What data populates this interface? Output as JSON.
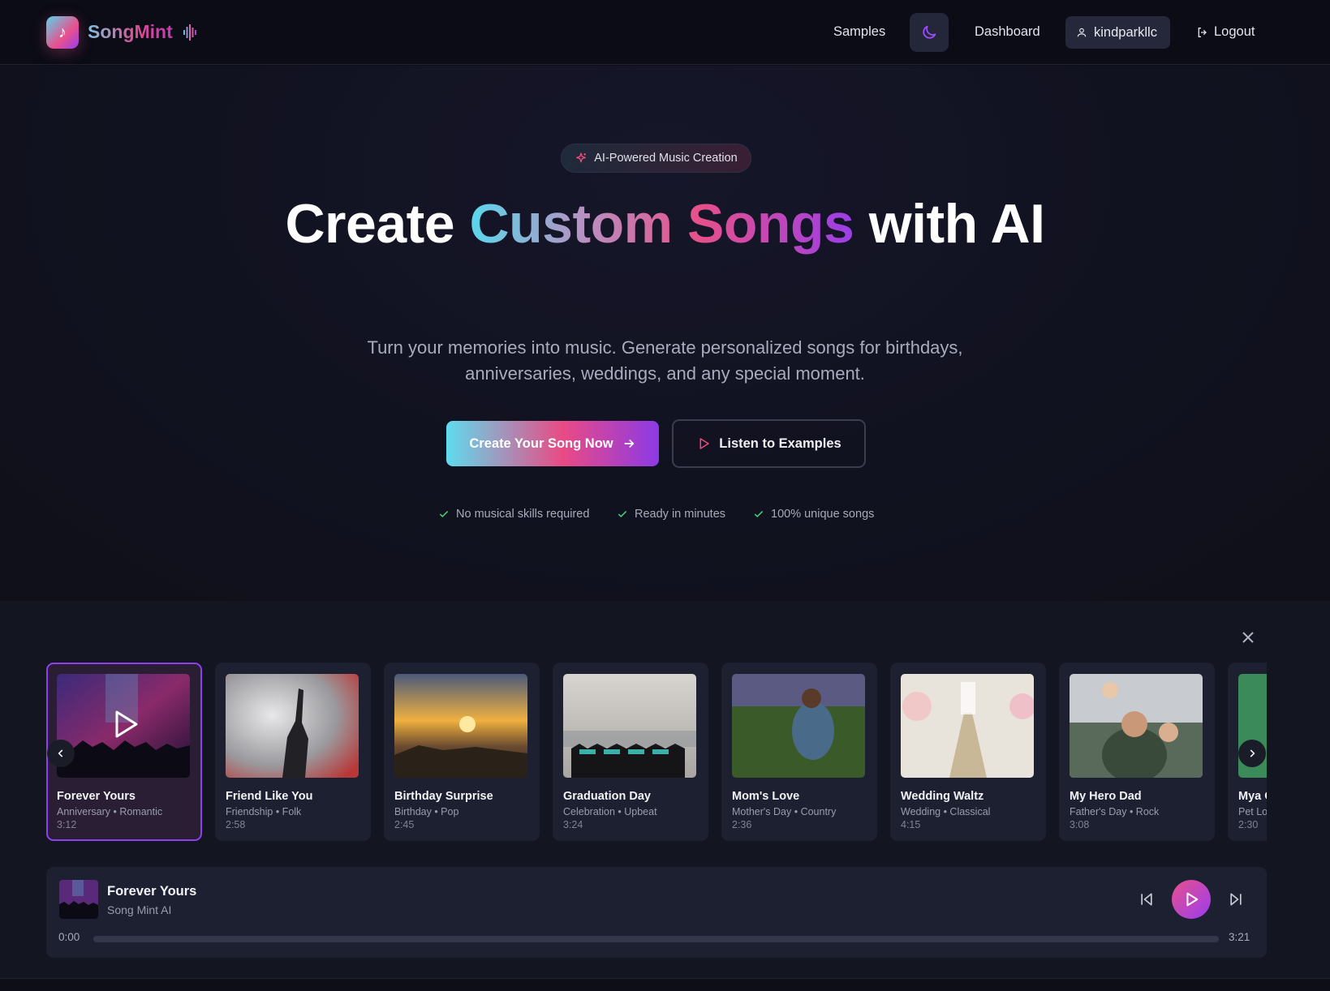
{
  "brand": {
    "name": "SongMint",
    "logo_glyph": "♪"
  },
  "nav": {
    "samples": "Samples",
    "dashboard": "Dashboard",
    "username": "kindparkllc",
    "logout": "Logout"
  },
  "hero": {
    "badge": "AI-Powered Music Creation",
    "headline_pre": "Create",
    "headline_accent": "Custom Songs",
    "headline_post": "with AI",
    "subtitle": "Turn your memories into music. Generate personalized songs for birthdays, anniversaries, weddings, and any special moment.",
    "cta_primary": "Create Your Song Now",
    "cta_secondary": "Listen to Examples",
    "features": [
      "No musical skills required",
      "Ready in minutes",
      "100% unique songs"
    ]
  },
  "samples": {
    "cards": [
      {
        "title": "Forever Yours",
        "meta": "Anniversary • Romantic",
        "duration": "3:12",
        "active": true
      },
      {
        "title": "Friend Like You",
        "meta": "Friendship • Folk",
        "duration": "2:58"
      },
      {
        "title": "Birthday Surprise",
        "meta": "Birthday • Pop",
        "duration": "2:45"
      },
      {
        "title": "Graduation Day",
        "meta": "Celebration • Upbeat",
        "duration": "3:24"
      },
      {
        "title": "Mom's Love",
        "meta": "Mother's Day • Country",
        "duration": "2:36"
      },
      {
        "title": "Wedding Waltz",
        "meta": "Wedding • Classical",
        "duration": "4:15"
      },
      {
        "title": "My Hero Dad",
        "meta": "Father's Day • Rock",
        "duration": "3:08"
      },
      {
        "title": "Mya C",
        "meta": "Pet Lo",
        "duration": "2:30"
      }
    ]
  },
  "player": {
    "title": "Forever Yours",
    "artist": "Song Mint AI",
    "current_time": "0:00",
    "total_time": "3:21",
    "progress": 0
  },
  "colors": {
    "accent_pink": "#e8508c",
    "accent_purple": "#8e3ff0",
    "accent_cyan": "#5ad8ec",
    "check_green": "#4ade80"
  }
}
